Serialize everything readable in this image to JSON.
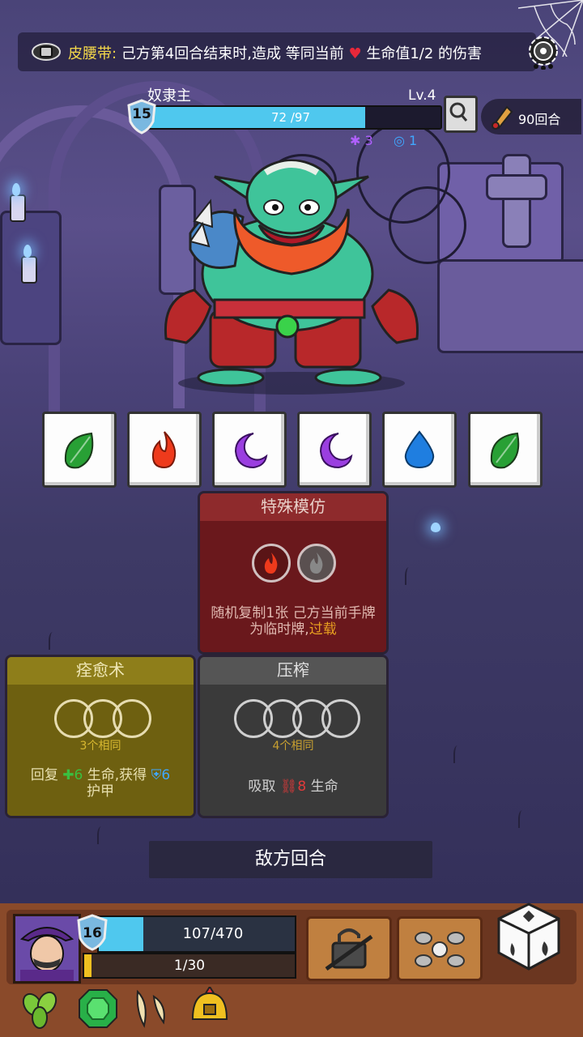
{
  "banner": {
    "belt_label": "皮腰带:",
    "text_before": "己方第4回合结束时,造成 等同当前",
    "heart": "♥",
    "text_after": "生命值1/2 的伤害"
  },
  "enemy": {
    "name": "奴隶主",
    "level": "Lv.4",
    "shield": "15",
    "hp_text": "72 /97",
    "hp_fraction": 0.742,
    "status_purple": "3",
    "status_blue": "1"
  },
  "turns": {
    "label": "90回合"
  },
  "dice": [
    {
      "icon": "leaf-icon",
      "color": "#28a035"
    },
    {
      "icon": "fire-icon",
      "color": "#ee3a1c"
    },
    {
      "icon": "moon-icon",
      "color": "#9a3ee0"
    },
    {
      "icon": "moon-icon",
      "color": "#9a3ee0"
    },
    {
      "icon": "water-drop-icon",
      "color": "#1f7ee0"
    },
    {
      "icon": "leaf-icon",
      "color": "#28a035"
    }
  ],
  "cards": {
    "mimic": {
      "title": "特殊模仿",
      "desc_main": "随机复制1张 己方当前手牌 为临时牌,",
      "desc_keyword": "过载"
    },
    "heal": {
      "title": "痊愈术",
      "requirement": "3个相同",
      "desc_a": "回复",
      "desc_heal_icon": "✚",
      "desc_heal_num": "6",
      "desc_b": " 生命,获得",
      "desc_armor_num": "6",
      "desc_c": "护甲"
    },
    "squeeze": {
      "title": "压榨",
      "requirement": "4个相同",
      "desc_a": "吸取 ",
      "desc_num": "8",
      "desc_b": " 生命"
    }
  },
  "enemy_turn_label": "敌方回合",
  "player": {
    "shield": "16",
    "hp_text": "107/470",
    "hp_fraction": 0.228,
    "xp_text": "1/30",
    "xp_fraction": 0.033
  },
  "colors": {
    "accent_gold": "#f4d84a",
    "hp_blue": "#4fc8ee",
    "card_red": "#7a1c20",
    "card_olive": "#7a6a10",
    "card_gray": "#3c3c3c"
  }
}
